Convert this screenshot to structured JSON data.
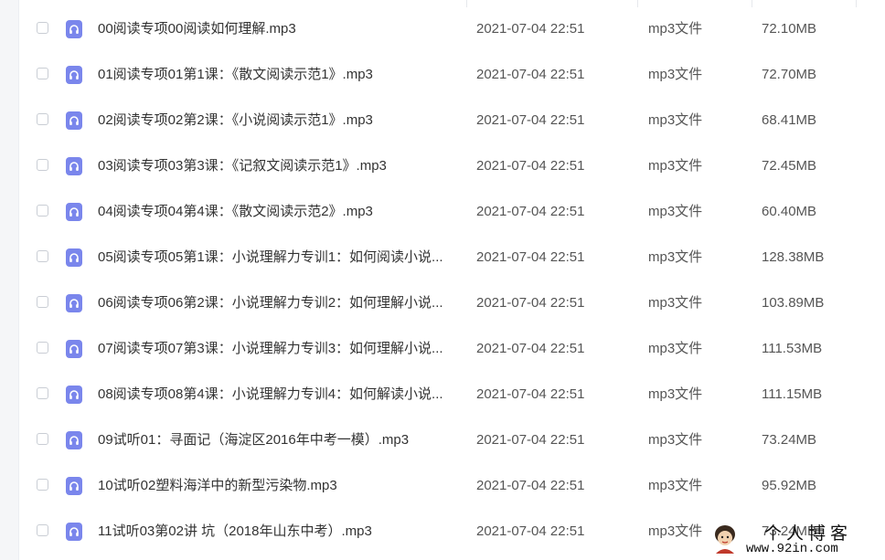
{
  "file_list": {
    "files": [
      {
        "name": "00阅读专项00阅读如何理解.mp3",
        "modified": "2021-07-04 22:51",
        "type": "mp3文件",
        "size": "72.10MB"
      },
      {
        "name": "01阅读专项01第1课：《散文阅读示范1》.mp3",
        "modified": "2021-07-04 22:51",
        "type": "mp3文件",
        "size": "72.70MB"
      },
      {
        "name": "02阅读专项02第2课：《小说阅读示范1》.mp3",
        "modified": "2021-07-04 22:51",
        "type": "mp3文件",
        "size": "68.41MB"
      },
      {
        "name": "03阅读专项03第3课：《记叙文阅读示范1》.mp3",
        "modified": "2021-07-04 22:51",
        "type": "mp3文件",
        "size": "72.45MB"
      },
      {
        "name": "04阅读专项04第4课：《散文阅读示范2》.mp3",
        "modified": "2021-07-04 22:51",
        "type": "mp3文件",
        "size": "60.40MB"
      },
      {
        "name": "05阅读专项05第1课：小说理解力专训1：如何阅读小说...",
        "modified": "2021-07-04 22:51",
        "type": "mp3文件",
        "size": "128.38MB"
      },
      {
        "name": "06阅读专项06第2课：小说理解力专训2：如何理解小说...",
        "modified": "2021-07-04 22:51",
        "type": "mp3文件",
        "size": "103.89MB"
      },
      {
        "name": "07阅读专项07第3课：小说理解力专训3：如何理解小说...",
        "modified": "2021-07-04 22:51",
        "type": "mp3文件",
        "size": "111.53MB"
      },
      {
        "name": "08阅读专项08第4课：小说理解力专训4：如何解读小说...",
        "modified": "2021-07-04 22:51",
        "type": "mp3文件",
        "size": "111.15MB"
      },
      {
        "name": "09试听01：寻面记（海淀区2016年中考一模）.mp3",
        "modified": "2021-07-04 22:51",
        "type": "mp3文件",
        "size": "73.24MB"
      },
      {
        "name": "10试听02塑料海洋中的新型污染物.mp3",
        "modified": "2021-07-04 22:51",
        "type": "mp3文件",
        "size": "95.92MB"
      },
      {
        "name": "11试听03第02讲 坑（2018年山东中考）.mp3",
        "modified": "2021-07-04 22:51",
        "type": "mp3文件",
        "size": "73.24MB"
      }
    ],
    "file_icon": "audio-headphones-icon",
    "icon_color": "#7a86ec"
  },
  "watermark": {
    "title": "个人博客",
    "url": "www.92in.com"
  }
}
